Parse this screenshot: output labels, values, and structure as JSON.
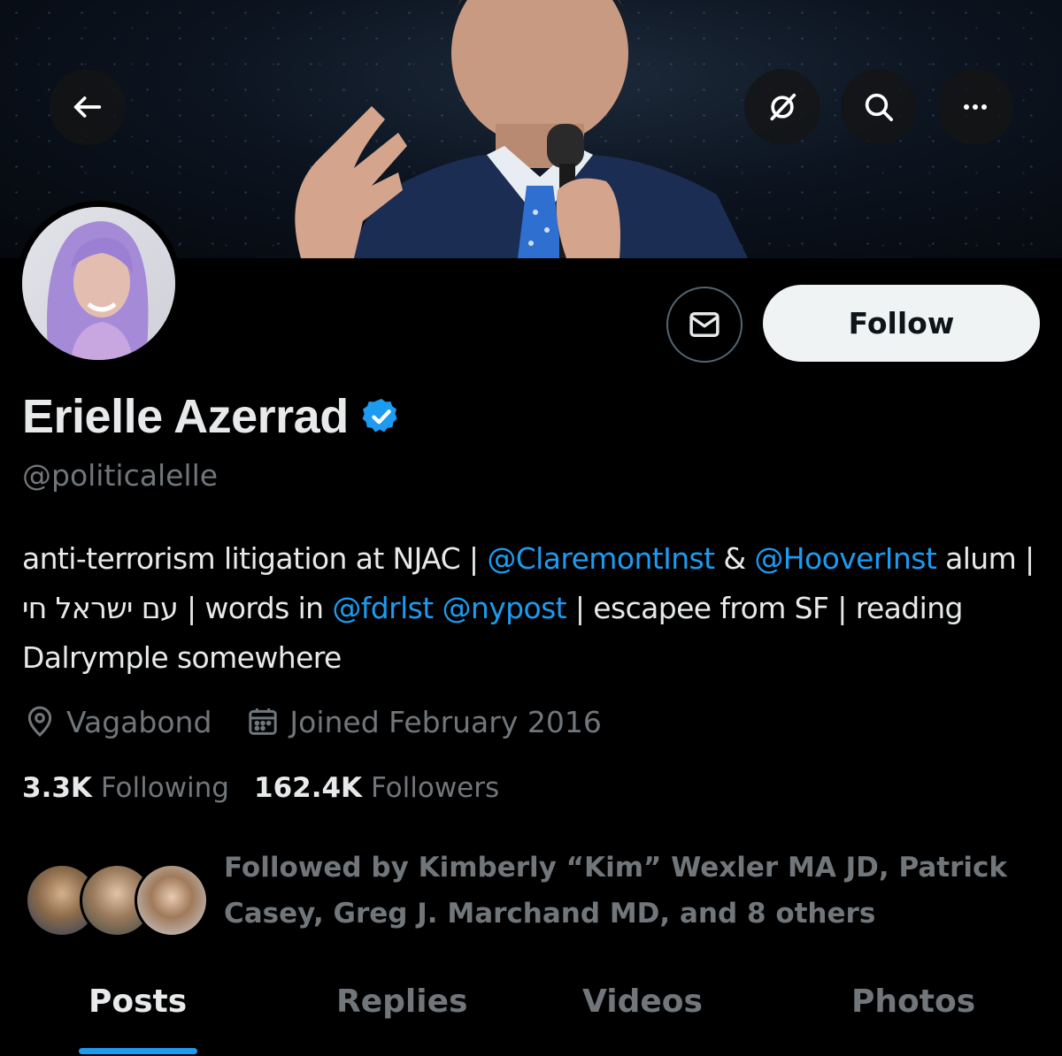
{
  "header": {
    "back_icon": "arrow-left-icon",
    "grok_icon": "grok-icon",
    "search_icon": "search-icon",
    "more_icon": "more-horizontal-icon"
  },
  "profile": {
    "name": "Erielle Azerrad",
    "handle": "@politicalelle",
    "verified": true,
    "verified_color": "#1d9bf0",
    "follow_label": "Follow",
    "message_icon": "envelope-icon",
    "bio": {
      "part1": "anti-terrorism litigation at NJAC | ",
      "mention1": "@ClaremontInst",
      "part2": " & ",
      "mention2": "@HooverInst",
      "part3": " alum | עם ישראל חי | words in ",
      "mention3": "@fdrlst",
      "part4": " ",
      "mention4": "@nypost",
      "part5": " | escapee from SF | reading Dalrymple somewhere"
    },
    "location": "Vagabond",
    "joined": "Joined February 2016",
    "following_count": "3.3K",
    "following_label": "Following",
    "followers_count": "162.4K",
    "followers_label": "Followers",
    "followed_by": "Followed by Kimberly “Kim” Wexler MA JD, Patrick Casey, Greg J. Marchand MD, and 8 others"
  },
  "tabs": [
    {
      "label": "Posts",
      "active": true
    },
    {
      "label": "Replies",
      "active": false
    },
    {
      "label": "Videos",
      "active": false
    },
    {
      "label": "Photos",
      "active": false
    }
  ],
  "colors": {
    "accent": "#1d9bf0",
    "background": "#000000",
    "secondary_text": "#71767b"
  }
}
